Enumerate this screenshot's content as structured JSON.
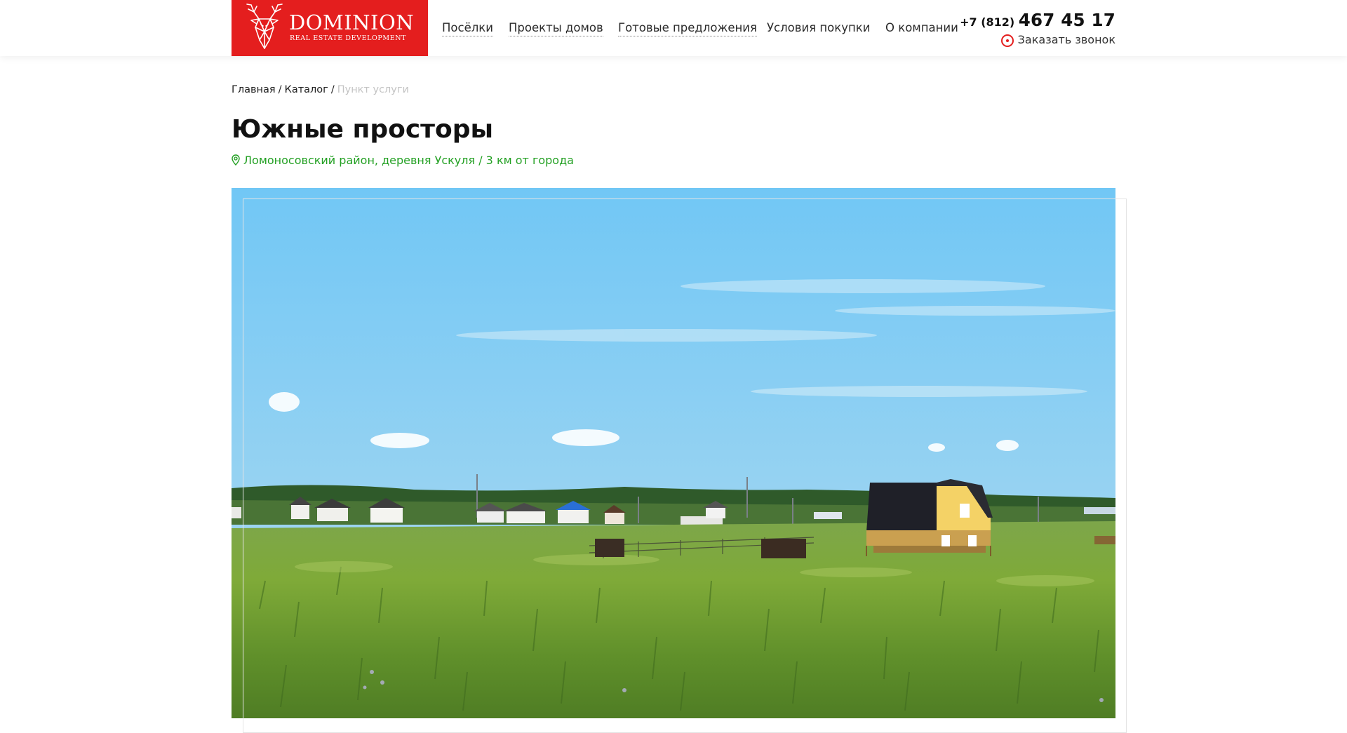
{
  "header": {
    "logo": {
      "brand": "DOMINION",
      "tagline": "REAL ESTATE DEVELOPMENT",
      "icon": "deer-head-icon",
      "background_color": "#e41e1e"
    },
    "nav": [
      {
        "label": "Посёлки"
      },
      {
        "label": "Проекты домов"
      },
      {
        "label": "Готовые предложения"
      },
      {
        "label": "Условия покупки"
      },
      {
        "label": "О компании"
      }
    ],
    "phone": {
      "code": "+7 (812)",
      "number": "467 45 17"
    },
    "callback": {
      "label": "Заказать звонок",
      "icon": "callback-dot-icon"
    }
  },
  "breadcrumb": {
    "items": [
      {
        "label": "Главная"
      },
      {
        "label": "Каталог"
      }
    ],
    "separator": "/",
    "current": "Пункт услуги"
  },
  "page": {
    "title": "Южные просторы",
    "location": "Ломоносовский район, деревня Ускуля / 3 км от города",
    "location_icon": "map-pin-icon",
    "location_color": "#23a023"
  },
  "photo": {
    "subject": "landscape-photo"
  }
}
